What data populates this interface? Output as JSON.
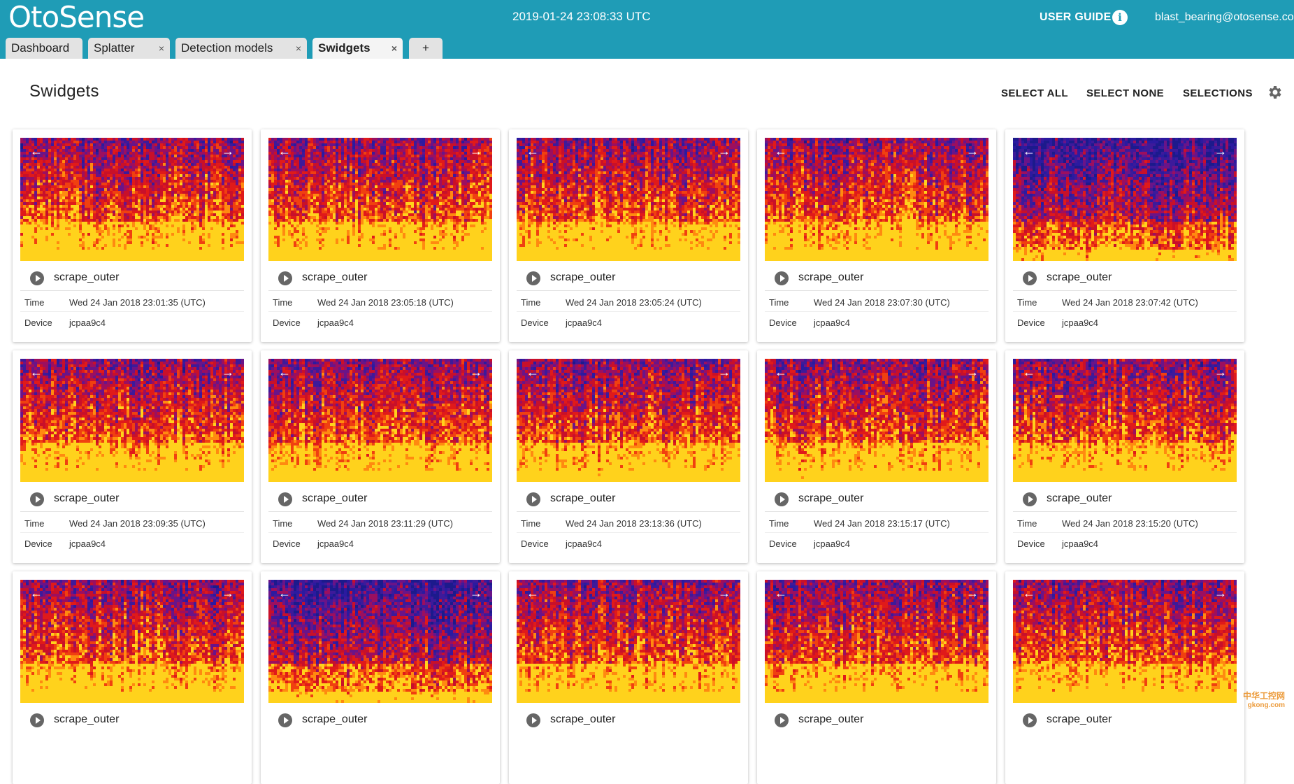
{
  "header": {
    "logo": "OtoSense",
    "timestamp": "2019-01-24 23:08:33 UTC",
    "user_guide": "USER GUIDE",
    "account": "blast_bearing@otosense.com"
  },
  "tabs": [
    {
      "label": "Dashboard",
      "closable": false
    },
    {
      "label": "Splatter",
      "close": "×"
    },
    {
      "label": "Detection models",
      "close": "×"
    },
    {
      "label": "Swidgets",
      "close": "×",
      "active": true
    },
    {
      "label": "+"
    }
  ],
  "page": {
    "title": "Swidgets",
    "actions": [
      "SELECT ALL",
      "SELECT NONE",
      "SELECTIONS"
    ]
  },
  "labels": {
    "time": "Time",
    "device": "Device"
  },
  "cards": [
    {
      "name": "scrape_outer",
      "time": "Wed 24 Jan 2018 23:01:35 (UTC)",
      "device": "jcpaa9c4"
    },
    {
      "name": "scrape_outer",
      "time": "Wed 24 Jan 2018 23:05:18 (UTC)",
      "device": "jcpaa9c4"
    },
    {
      "name": "scrape_outer",
      "time": "Wed 24 Jan 2018 23:05:24 (UTC)",
      "device": "jcpaa9c4"
    },
    {
      "name": "scrape_outer",
      "time": "Wed 24 Jan 2018 23:07:30 (UTC)",
      "device": "jcpaa9c4"
    },
    {
      "name": "scrape_outer",
      "time": "Wed 24 Jan 2018 23:07:42 (UTC)",
      "device": "jcpaa9c4"
    },
    {
      "name": "scrape_outer",
      "time": "Wed 24 Jan 2018 23:09:35 (UTC)",
      "device": "jcpaa9c4"
    },
    {
      "name": "scrape_outer",
      "time": "Wed 24 Jan 2018 23:11:29 (UTC)",
      "device": "jcpaa9c4"
    },
    {
      "name": "scrape_outer",
      "time": "Wed 24 Jan 2018 23:13:36 (UTC)",
      "device": "jcpaa9c4"
    },
    {
      "name": "scrape_outer",
      "time": "Wed 24 Jan 2018 23:15:17 (UTC)",
      "device": "jcpaa9c4"
    },
    {
      "name": "scrape_outer",
      "time": "Wed 24 Jan 2018 23:15:20 (UTC)",
      "device": "jcpaa9c4"
    },
    {
      "name": "scrape_outer"
    },
    {
      "name": "scrape_outer"
    },
    {
      "name": "scrape_outer"
    },
    {
      "name": "scrape_outer"
    },
    {
      "name": "scrape_outer"
    }
  ],
  "icons": {
    "prev": "arrow-left-icon",
    "next": "arrow-right-icon",
    "play": "play-icon",
    "settings": "gear-icon",
    "info": "info-icon"
  },
  "colors": {
    "header_bg": "#1f9cb6",
    "spectrogram_low": "#1c1a8c",
    "spectrogram_mid": "#d1141e",
    "spectrogram_high": "#ffd21c"
  },
  "watermark": {
    "line1": "中华工控网",
    "line2": "gkong.com"
  }
}
